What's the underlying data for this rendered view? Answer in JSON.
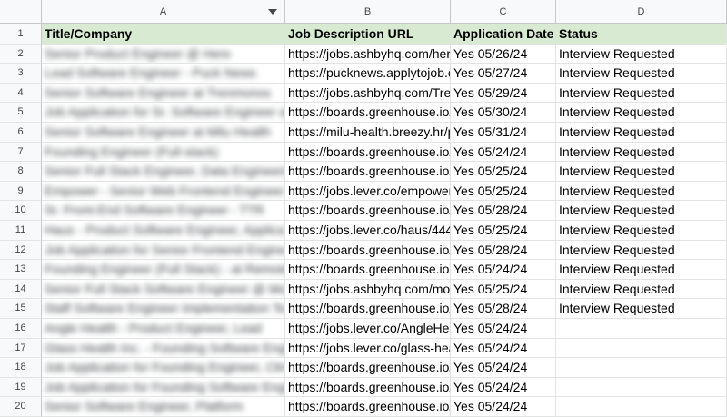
{
  "columns": [
    "A",
    "B",
    "C",
    "D"
  ],
  "header": {
    "title_company": "Title/Company",
    "job_url": "Job Description URL",
    "application_date": "Application Date",
    "status": "Status"
  },
  "rows": [
    {
      "num": "2",
      "title": "Senior Product Engineer @ Here",
      "url": "https://jobs.ashbyhq.com/here",
      "date": "Yes 05/26/24",
      "status": "Interview Requested"
    },
    {
      "num": "3",
      "title": "Lead Software Engineer - Puck News",
      "url": "https://pucknews.applytojob.c",
      "date": "Yes 05/27/24",
      "status": "Interview Requested"
    },
    {
      "num": "4",
      "title": "Senior Software Engineer at Trenmonos",
      "url": "https://jobs.ashbyhq.com/Trer",
      "date": "Yes 05/29/24",
      "status": "Interview Requested"
    },
    {
      "num": "5",
      "title": "Job Application for Sr. Software Engineer at",
      "url": "https://boards.greenhouse.io/t",
      "date": "Yes 05/30/24",
      "status": "Interview Requested"
    },
    {
      "num": "6",
      "title": "Senior Software Engineer at Milu Health",
      "url": "https://milu-health.breezy.hr/p",
      "date": "Yes 05/31/24",
      "status": "Interview Requested"
    },
    {
      "num": "7",
      "title": "Founding Engineer (Full-stack)",
      "url": "https://boards.greenhouse.io/a",
      "date": "Yes 05/24/24",
      "status": "Interview Requested"
    },
    {
      "num": "8",
      "title": "Senior Full Stack Engineer, Data Engineering",
      "url": "https://boards.greenhouse.io/t",
      "date": "Yes 05/25/24",
      "status": "Interview Requested"
    },
    {
      "num": "9",
      "title": "Empower - Senior Web Frontend Engineer",
      "url": "https://jobs.lever.co/empower.",
      "date": "Yes 05/25/24",
      "status": "Interview Requested"
    },
    {
      "num": "10",
      "title": "Sr. Front-End Software Engineer - TTR",
      "url": "https://boards.greenhouse.io/l",
      "date": "Yes 05/28/24",
      "status": "Interview Requested"
    },
    {
      "num": "11",
      "title": "Haus - Product Software Engineer, Applica",
      "url": "https://jobs.lever.co/haus/444(",
      "date": "Yes 05/25/24",
      "status": "Interview Requested"
    },
    {
      "num": "12",
      "title": "Job Application for Senior Frontend Engine",
      "url": "https://boards.greenhouse.io/a",
      "date": "Yes 05/28/24",
      "status": "Interview Requested"
    },
    {
      "num": "13",
      "title": "Founding Engineer (Full Stack) - at Remote",
      "url": "https://boards.greenhouse.io/a",
      "date": "Yes 05/24/24",
      "status": "Interview Requested"
    },
    {
      "num": "14",
      "title": "Senior Full Stack Software Engineer @ Mos",
      "url": "https://jobs.ashbyhq.com/mos",
      "date": "Yes 05/25/24",
      "status": "Interview Requested"
    },
    {
      "num": "15",
      "title": "Staff Software Engineer Implementation Te",
      "url": "https://boards.greenhouse.io/c",
      "date": "Yes 05/28/24",
      "status": "Interview Requested"
    },
    {
      "num": "16",
      "title": "Angle Health - Product Engineer, Lead",
      "url": "https://jobs.lever.co/AngleHea",
      "date": "Yes 05/24/24",
      "status": ""
    },
    {
      "num": "17",
      "title": "Glass Health Inc. - Founding Software Engin",
      "url": "https://jobs.lever.co/glass-hea",
      "date": "Yes 05/24/24",
      "status": ""
    },
    {
      "num": "18",
      "title": "Job Application for Founding Engineer, Clin",
      "url": "https://boards.greenhouse.io/a",
      "date": "Yes 05/24/24",
      "status": ""
    },
    {
      "num": "19",
      "title": "Job Application for Founding Software Engin",
      "url": "https://boards.greenhouse.io/s",
      "date": "Yes 05/24/24",
      "status": ""
    },
    {
      "num": "20",
      "title": "Senior Software Engineer, Platform",
      "url": "https://boards.greenhouse.io/a",
      "date": "Yes 05/24/24",
      "status": ""
    }
  ]
}
